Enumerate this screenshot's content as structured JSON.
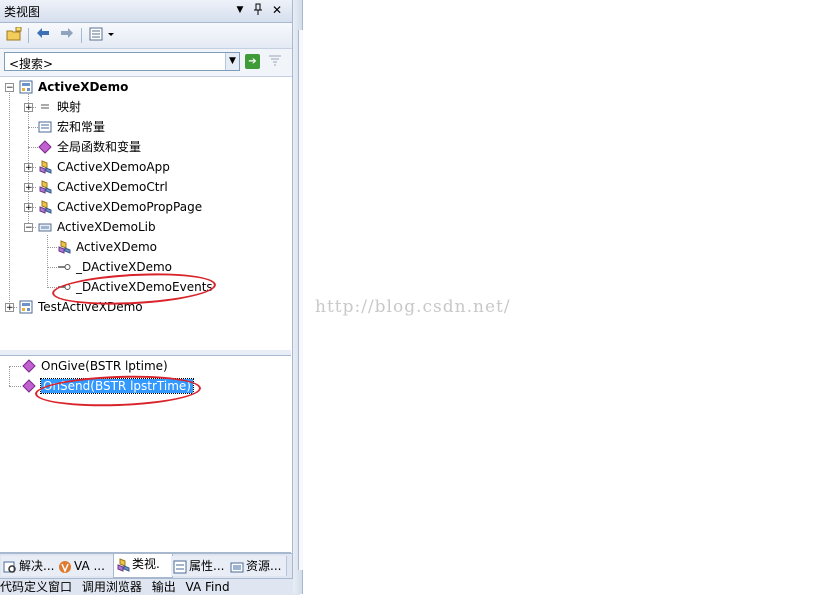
{
  "panel": {
    "title": "类视图",
    "title_buttons": {
      "dropdown": "▼",
      "pin": "ꟷ",
      "close": "✕"
    }
  },
  "toolbar": {
    "items": [
      "new-folder-icon",
      "back-arrow-icon",
      "forward-arrow-icon",
      "class-view-settings-icon"
    ]
  },
  "search": {
    "value": "<搜索>",
    "go_icon": "go-arrow-icon",
    "filter_icon": "clear-search-icon"
  },
  "tree": {
    "nodes": [
      {
        "label": "ActiveXDemo",
        "icon": "project-icon",
        "expander": "−"
      },
      {
        "label": "映射",
        "icon": "map-icon",
        "expander": "+"
      },
      {
        "label": "宏和常量",
        "icon": "macro-icon"
      },
      {
        "label": "全局函数和变量",
        "icon": "global-function-icon"
      },
      {
        "label": "CActiveXDemoApp",
        "icon": "class-icon",
        "expander": "+"
      },
      {
        "label": "CActiveXDemoCtrl",
        "icon": "class-icon",
        "expander": "+"
      },
      {
        "label": "CActiveXDemoPropPage",
        "icon": "class-icon",
        "expander": "+"
      },
      {
        "label": "ActiveXDemoLib",
        "icon": "library-icon",
        "expander": "−"
      },
      {
        "label": "ActiveXDemo",
        "icon": "coclass-icon"
      },
      {
        "label": "_DActiveXDemo",
        "icon": "interface-icon"
      },
      {
        "label": "_DActiveXDemoEvents",
        "icon": "interface-icon"
      },
      {
        "label": "TestActiveXDemo",
        "icon": "project-icon",
        "expander": "+"
      }
    ]
  },
  "members": {
    "items": [
      {
        "label": "OnGive(BSTR lptime)",
        "icon": "method-icon"
      },
      {
        "label": "OnSend(BSTR lpstrTime)",
        "icon": "method-icon",
        "selected": true
      }
    ]
  },
  "tabs": [
    {
      "label": "解决...",
      "icon": "solution-icon"
    },
    {
      "label": "VA ...",
      "icon": "va-icon"
    },
    {
      "label": "类视.",
      "icon": "class-view-icon",
      "active": true
    },
    {
      "label": "属性...",
      "icon": "properties-icon"
    },
    {
      "label": "资源...",
      "icon": "resource-icon"
    }
  ],
  "bottom_strip": [
    "代码定义窗口",
    "调用浏览器",
    "输出",
    "VA Find"
  ],
  "watermark": "http://blog.csdn.net/",
  "colors": {
    "highlight": "#d9232a",
    "selection": "#3399ff",
    "panel_border": "#a7b8cf"
  }
}
